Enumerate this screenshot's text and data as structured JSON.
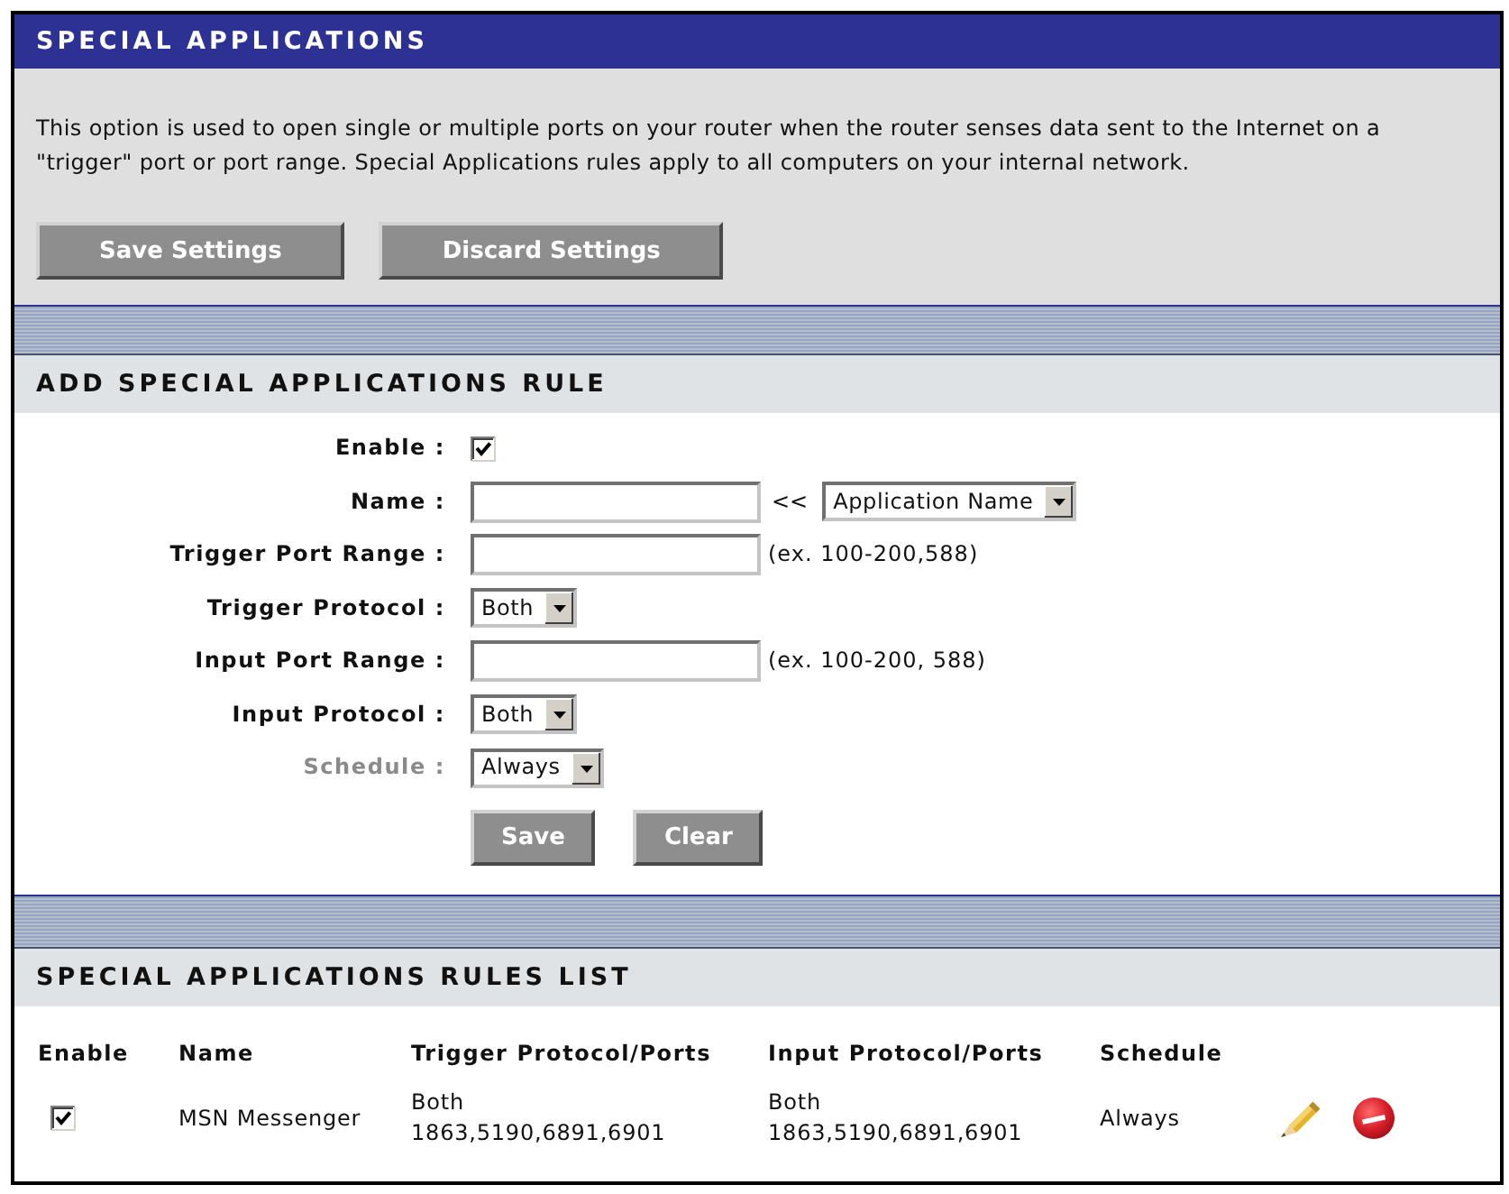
{
  "page_header": {
    "title": "SPECIAL APPLICATIONS",
    "description": "This option is used to open single or multiple ports on your router when the router senses data sent to the Internet on a \"trigger\" port or port range. Special Applications rules apply to all computers on your internal network.",
    "buttons": [
      "Save Settings",
      "Discard Settings"
    ]
  },
  "add_rule": {
    "title": "ADD SPECIAL APPLICATIONS RULE",
    "fields": [
      {
        "kind": "checkbox",
        "label": "Enable :",
        "dimmed": false,
        "checked": true
      },
      {
        "kind": "text",
        "label": "Name :",
        "dimmed": false,
        "separator": "<<",
        "picker": "Application Name"
      },
      {
        "kind": "text",
        "label": "Trigger Port Range :",
        "dimmed": false,
        "hint": "(ex. 100-200,588)"
      },
      {
        "kind": "select",
        "label": "Trigger Protocol :",
        "dimmed": false,
        "value": "Both"
      },
      {
        "kind": "text",
        "label": "Input Port Range :",
        "dimmed": false,
        "hint": "(ex. 100-200, 588)"
      },
      {
        "kind": "select",
        "label": "Input Protocol :",
        "dimmed": false,
        "value": "Both"
      },
      {
        "kind": "select",
        "label": "Schedule :",
        "dimmed": true,
        "value": "Always"
      }
    ],
    "buttons": [
      "Save",
      "Clear"
    ]
  },
  "rules_list": {
    "title": "SPECIAL APPLICATIONS RULES LIST",
    "columns": [
      "Enable",
      "Name",
      "Trigger Protocol/Ports",
      "Input Protocol/Ports",
      "Schedule"
    ],
    "rows": [
      {
        "checked": true,
        "name": "MSN Messenger",
        "trigger_protocol": "Both",
        "trigger_ports": "1863,5190,6891,6901",
        "input_protocol": "Both",
        "input_ports": "1863,5190,6891,6901",
        "schedule": "Always"
      }
    ]
  }
}
